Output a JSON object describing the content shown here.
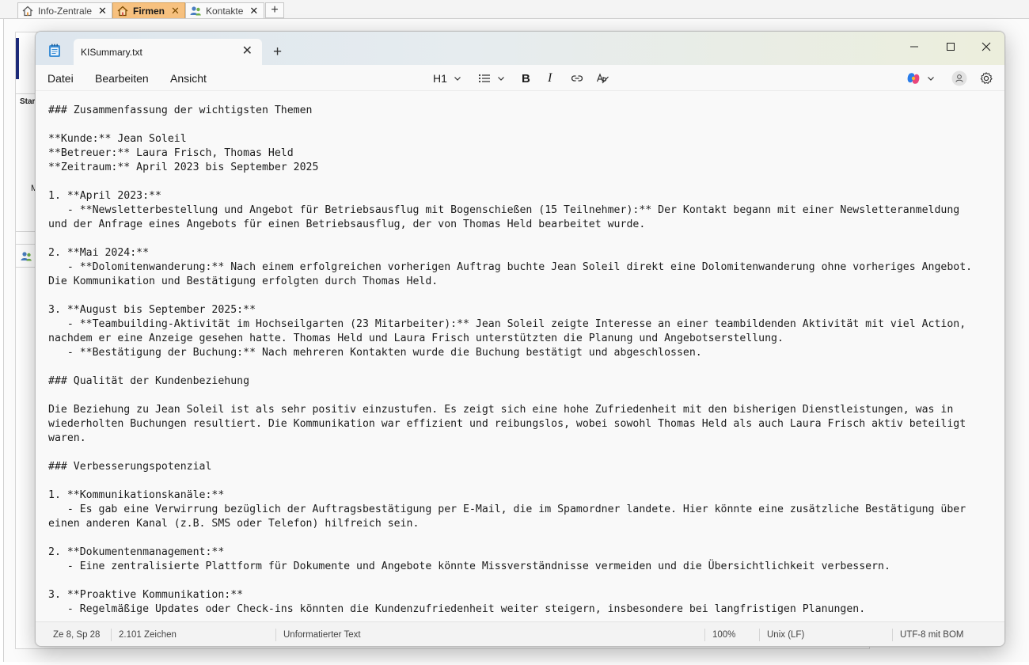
{
  "app": {
    "tabs": [
      {
        "label": "Info-Zentrale",
        "icon": "home-icon",
        "active": false
      },
      {
        "label": "Firmen",
        "icon": "home-icon",
        "active": true
      },
      {
        "label": "Kontakte",
        "icon": "contacts-icon",
        "active": false
      }
    ],
    "add_tab": "+",
    "bg_fragment_1": "Star",
    "bg_fragment_2": "M"
  },
  "notepad": {
    "doc_tab_title": "KISummary.txt",
    "new_tab": "+",
    "menu": [
      "Datei",
      "Bearbeiten",
      "Ansicht"
    ],
    "toolbar": {
      "heading_label": "H1",
      "bold_label": "B",
      "italic_label": "I"
    },
    "content": [
      "### Zusammenfassung der wichtigsten Themen",
      "",
      "**Kunde:** Jean Soleil",
      "**Betreuer:** Laura Frisch, Thomas Held",
      "**Zeitraum:** April 2023 bis September 2025",
      "",
      "1. **April 2023:**",
      "   - **Newsletterbestellung und Angebot für Betriebsausflug mit Bogenschießen (15 Teilnehmer):** Der Kontakt begann mit einer Newsletteranmeldung",
      "und der Anfrage eines Angebots für einen Betriebsausflug, der von Thomas Held bearbeitet wurde.",
      "",
      "2. **Mai 2024:**",
      "   - **Dolomitenwanderung:** Nach einem erfolgreichen vorherigen Auftrag buchte Jean Soleil direkt eine Dolomitenwanderung ohne vorheriges Angebot.",
      "Die Kommunikation und Bestätigung erfolgten durch Thomas Held.",
      "",
      "3. **August bis September 2025:**",
      "   - **Teambuilding-Aktivität im Hochseilgarten (23 Mitarbeiter):** Jean Soleil zeigte Interesse an einer teambildenden Aktivität mit viel Action,",
      "nachdem er eine Anzeige gesehen hatte. Thomas Held und Laura Frisch unterstützten die Planung und Angebotserstellung.",
      "   - **Bestätigung der Buchung:** Nach mehreren Kontakten wurde die Buchung bestätigt und abgeschlossen.",
      "",
      "### Qualität der Kundenbeziehung",
      "",
      "Die Beziehung zu Jean Soleil ist als sehr positiv einzustufen. Es zeigt sich eine hohe Zufriedenheit mit den bisherigen Dienstleistungen, was in",
      "wiederholten Buchungen resultiert. Die Kommunikation war effizient und reibungslos, wobei sowohl Thomas Held als auch Laura Frisch aktiv beteiligt",
      "waren.",
      "",
      "### Verbesserungspotenzial",
      "",
      "1. **Kommunikationskanäle:**",
      "   - Es gab eine Verwirrung bezüglich der Auftragsbestätigung per E-Mail, die im Spamordner landete. Hier könnte eine zusätzliche Bestätigung über",
      "einen anderen Kanal (z.B. SMS oder Telefon) hilfreich sein.",
      "",
      "2. **Dokumentenmanagement:**",
      "   - Eine zentralisierte Plattform für Dokumente und Angebote könnte Missverständnisse vermeiden und die Übersichtlichkeit verbessern.",
      "",
      "3. **Proaktive Kommunikation:**",
      "   - Regelmäßige Updates oder Check-ins könnten die Kundenzufriedenheit weiter steigern, insbesondere bei langfristigen Planungen."
    ],
    "status": {
      "position": "Ze 8, Sp 28",
      "chars": "2.101 Zeichen",
      "format": "Unformatierter Text",
      "zoom": "100%",
      "line_ending": "Unix (LF)",
      "encoding": "UTF-8 mit BOM"
    }
  },
  "colors": {
    "active_tab": "#f7c17f",
    "accent_dark_blue": "#1c2a7a"
  }
}
